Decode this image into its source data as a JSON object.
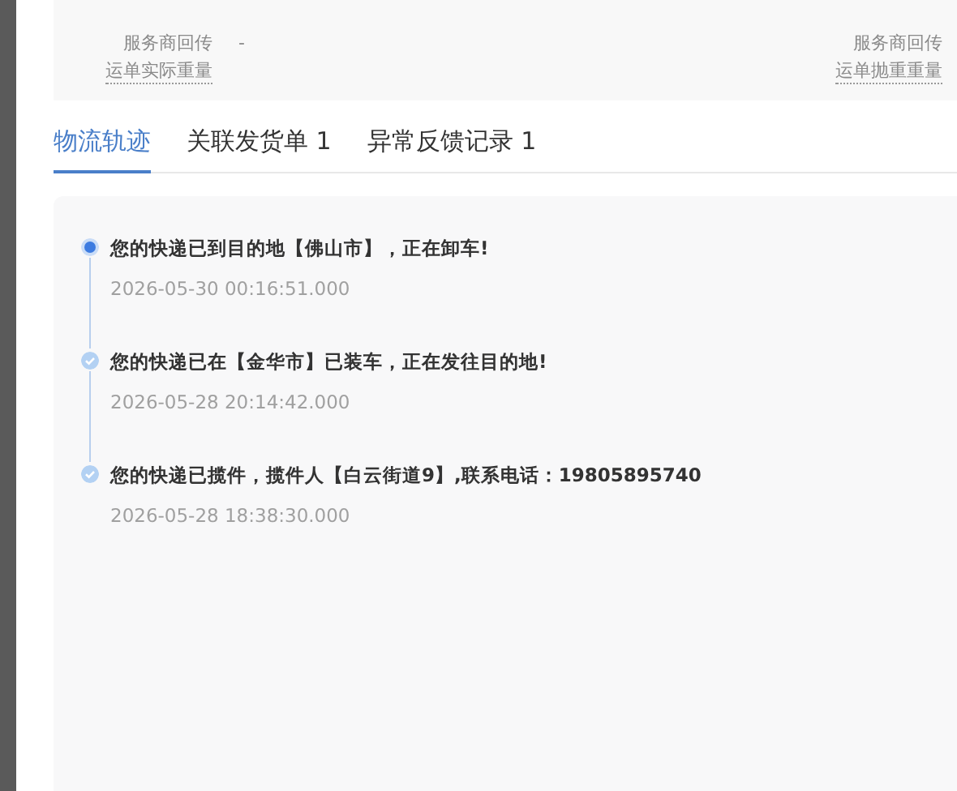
{
  "info_fields": [
    {
      "source": "服务商回传",
      "label": "运单实际重量",
      "value": "-"
    },
    {
      "source": "服务商回传",
      "label": "运单抛重重量"
    }
  ],
  "tabs": [
    {
      "label": "物流轨迹",
      "selected": true
    },
    {
      "label": "关联发货单 1",
      "selected": false
    },
    {
      "label": "异常反馈记录 1",
      "selected": false
    }
  ],
  "timeline": [
    {
      "title": "您的快递已到目的地【佛山市】，正在卸车!",
      "time": "2026-05-30 00:16:51.000",
      "current": true
    },
    {
      "title": "您的快递已在【金华市】已装车，正在发往目的地!",
      "time": "2026-05-28 20:14:42.000",
      "current": false
    },
    {
      "title": "您的快递已揽件，揽件人【白云街道9】,联系电话：19805895740",
      "time": "2026-05-28 18:38:30.000",
      "current": false
    }
  ]
}
